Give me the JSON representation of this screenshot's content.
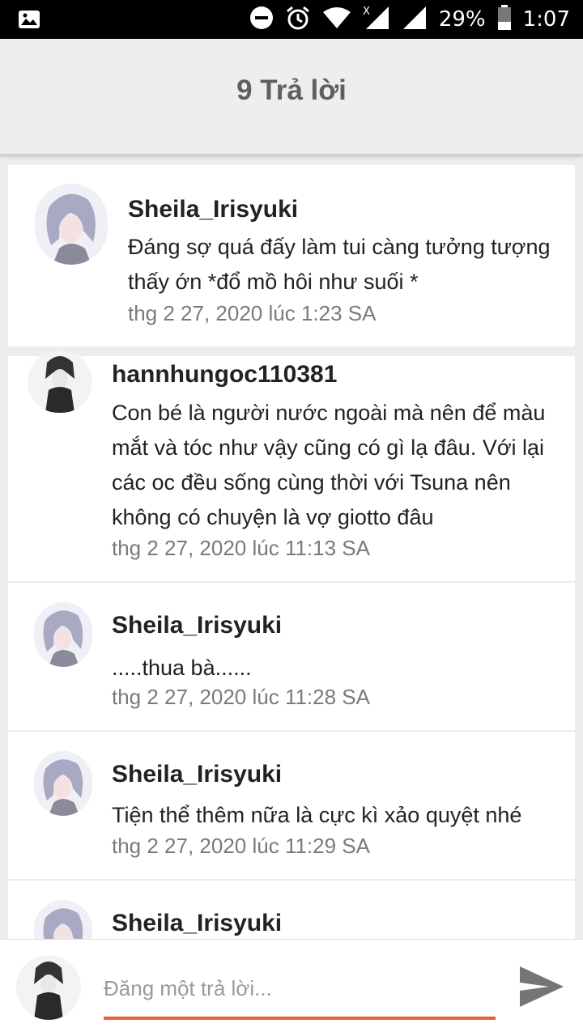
{
  "status_bar": {
    "battery": "29%",
    "time": "1:07",
    "icons": [
      "image-icon",
      "dnd-icon",
      "alarm-icon",
      "wifi-icon",
      "no-signal-icon",
      "signal-icon",
      "battery-icon"
    ]
  },
  "header": {
    "title": "9 Trả lời"
  },
  "comments": [
    {
      "username": "Sheila_Irisyuki",
      "text": "Đáng sợ quá đấy làm tui càng tưởng tượng thấy ớn *đổ mồ hôi như suối *",
      "time": "thg 2 27, 2020 lúc 1:23 SA"
    },
    {
      "username": "hannhungoc110381",
      "text": "Con bé là người nước ngoài mà nên để màu mắt và tóc như vậy cũng có gì lạ đâu. Với lại các oc đều sống cùng thời với Tsuna nên không có chuyện là vợ giotto đâu",
      "time": "thg 2 27, 2020 lúc 11:13 SA"
    },
    {
      "username": "Sheila_Irisyuki",
      "text": ".....thua bà......",
      "time": "thg 2 27, 2020 lúc 11:28 SA"
    },
    {
      "username": "Sheila_Irisyuki",
      "text": "Tiện thể thêm nữa là cực kì xảo quyệt nhé",
      "time": "thg 2 27, 2020 lúc 11:29 SA"
    },
    {
      "username": "Sheila_Irisyuki"
    }
  ],
  "reply": {
    "placeholder": "Đăng một trả lời..."
  },
  "colors": {
    "accent": "#e8603a",
    "header_bg": "#eeeeee",
    "page_bg": "#ededed"
  }
}
